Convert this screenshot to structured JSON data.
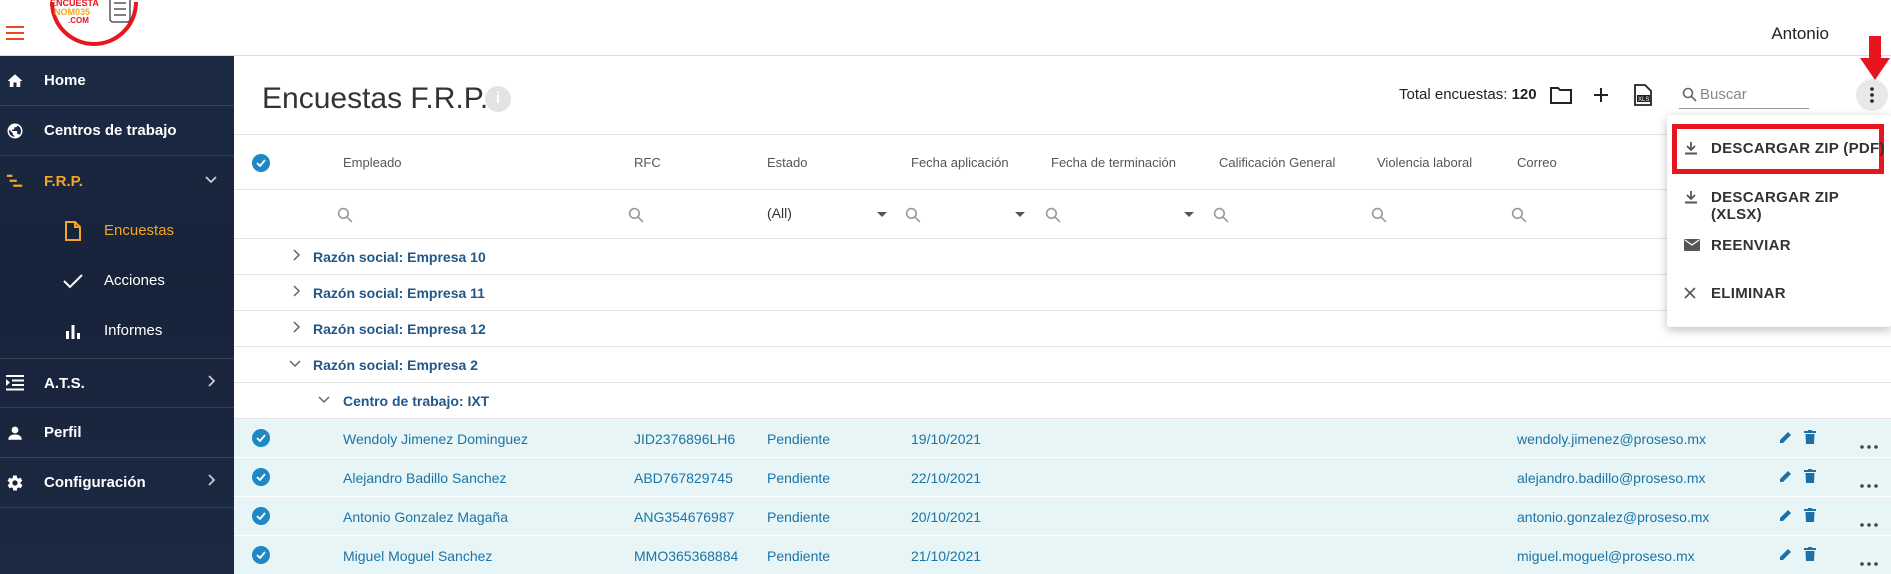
{
  "header": {
    "user_name": "Antonio",
    "logo_text_line1": "ENCUESTA",
    "logo_text_line2": "NOM035",
    "logo_text_line3": ".COM"
  },
  "sidebar": {
    "items": [
      {
        "label": "Home",
        "icon": "home-icon"
      },
      {
        "label": "Centros de trabajo",
        "icon": "globe-icon"
      },
      {
        "label": "F.R.P.",
        "icon": "list-icon",
        "expanded": true
      },
      {
        "label": "A.T.S.",
        "icon": "menu-list-icon"
      },
      {
        "label": "Perfil",
        "icon": "person-icon"
      },
      {
        "label": "Configuración",
        "icon": "gear-icon"
      }
    ],
    "subitems": [
      {
        "label": "Encuestas",
        "icon": "document-icon",
        "active": true
      },
      {
        "label": "Acciones",
        "icon": "check-icon"
      },
      {
        "label": "Informes",
        "icon": "bar-chart-icon"
      }
    ]
  },
  "page": {
    "title": "Encuestas F.R.P.",
    "info_icon_text": "i",
    "total_label": "Total encuestas:",
    "total_value": "120",
    "search_placeholder": "Buscar"
  },
  "table": {
    "columns": [
      "Empleado",
      "RFC",
      "Estado",
      "Fecha aplicación",
      "Fecha de terminación",
      "Calificación General",
      "Violencia laboral",
      "Correo"
    ],
    "estado_filter_value": "(All)",
    "groups": [
      {
        "label": "Razón social: Empresa 10",
        "expanded": false
      },
      {
        "label": "Razón social: Empresa 11",
        "expanded": false
      },
      {
        "label": "Razón social: Empresa 12",
        "expanded": false
      },
      {
        "label": "Razón social: Empresa 2",
        "expanded": true
      }
    ],
    "subgroup": {
      "label": "Centro de trabajo: IXT",
      "expanded": true
    },
    "rows": [
      {
        "empleado": "Wendoly Jimenez Dominguez",
        "rfc": "JID2376896LH6",
        "estado": "Pendiente",
        "fecha": "19/10/2021",
        "correo": "wendoly.jimenez@proseso.mx"
      },
      {
        "empleado": "Alejandro Badillo Sanchez",
        "rfc": "ABD767829745",
        "estado": "Pendiente",
        "fecha": "22/10/2021",
        "correo": "alejandro.badillo@proseso.mx"
      },
      {
        "empleado": "Antonio Gonzalez Magaña",
        "rfc": "ANG354676987",
        "estado": "Pendiente",
        "fecha": "20/10/2021",
        "correo": "antonio.gonzalez@proseso.mx"
      },
      {
        "empleado": "Miguel Moguel Sanchez",
        "rfc": "MMO365368884",
        "estado": "Pendiente",
        "fecha": "21/10/2021",
        "correo": "miguel.moguel@proseso.mx"
      }
    ]
  },
  "menu": {
    "items": [
      {
        "label": "DESCARGAR ZIP (PDF)",
        "icon": "download-icon",
        "highlighted": true
      },
      {
        "label": "DESCARGAR ZIP (XLSX)",
        "icon": "download-icon"
      },
      {
        "label": "REENVIAR",
        "icon": "mail-icon"
      },
      {
        "label": "ELIMINAR",
        "icon": "close-icon"
      }
    ]
  },
  "colors": {
    "sidebar_bg": "#1c2a44",
    "accent_orange": "#f5a623",
    "link_blue": "#1b74a6",
    "row_highlight": "#e7f5f7",
    "annotation_red": "#e8141e"
  }
}
